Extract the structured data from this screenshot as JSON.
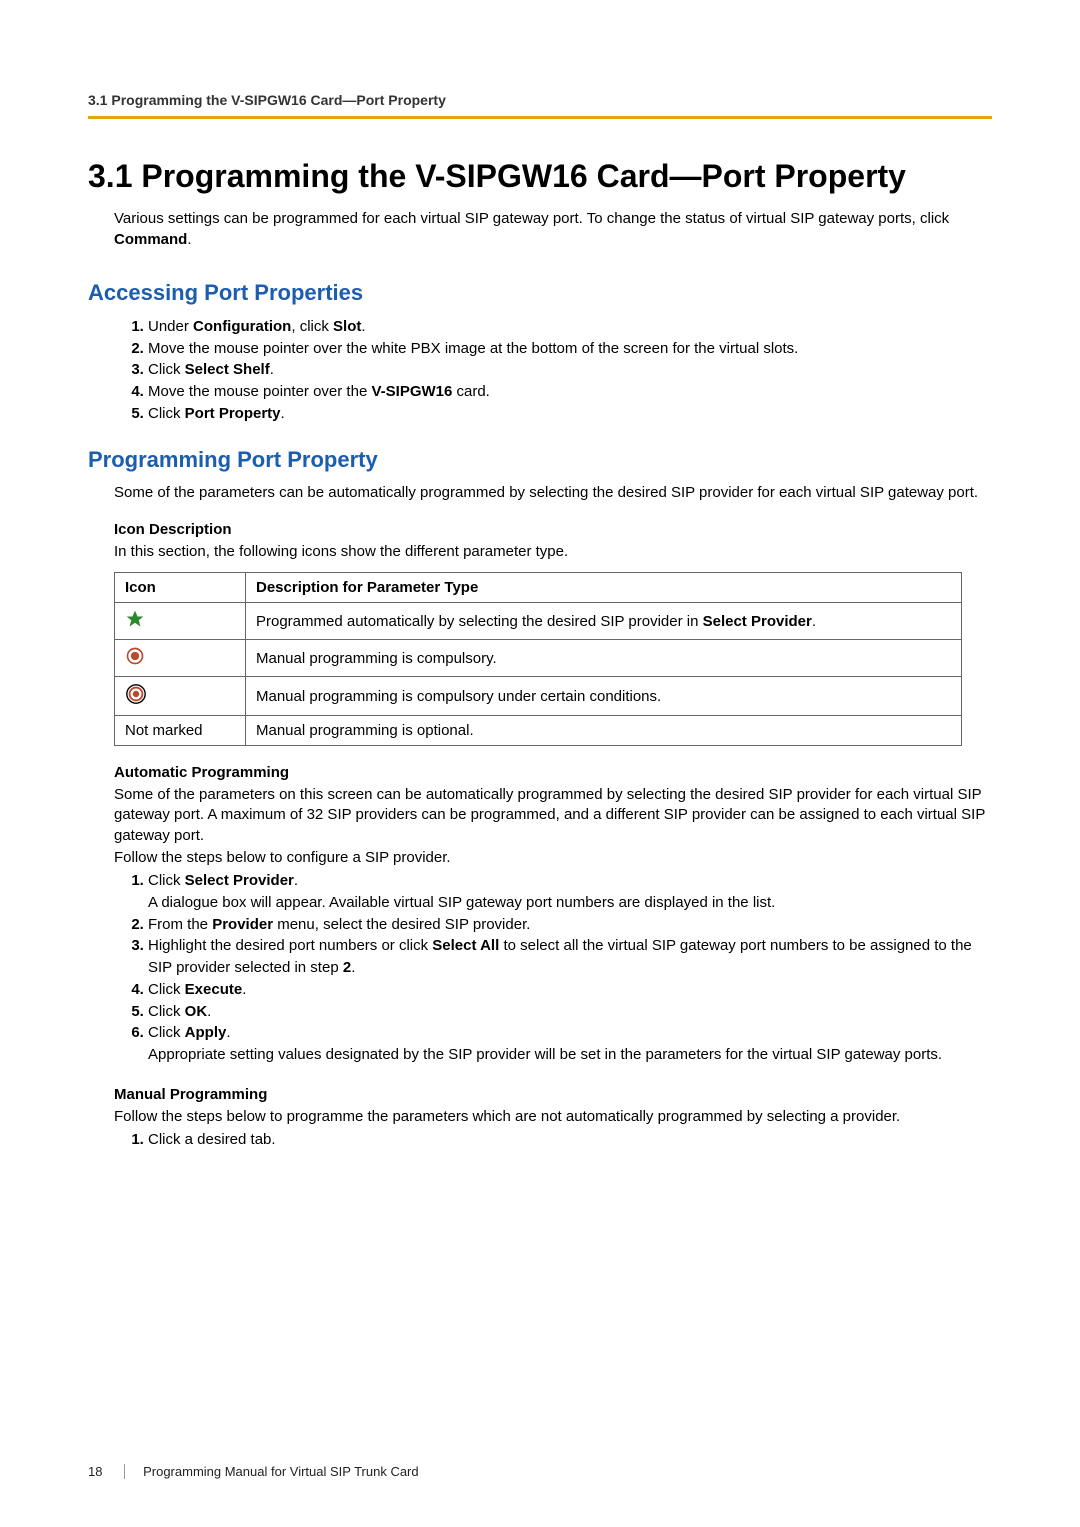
{
  "header": {
    "running": "3.1 Programming the V-SIPGW16 Card—Port Property"
  },
  "title": "3.1  Programming the V-SIPGW16 Card—Port Property",
  "intro": {
    "text_a": "Various settings can be programmed for each virtual SIP gateway port. To change the status of virtual SIP gateway ports, click ",
    "bold_a": "Command",
    "text_b": "."
  },
  "section_accessing": {
    "heading": "Accessing Port Properties",
    "steps": [
      {
        "pre": "Under ",
        "b1": "Configuration",
        "mid": ", click ",
        "b2": "Slot",
        "post": "."
      },
      {
        "text": "Move the mouse pointer over the white PBX image at the bottom of the screen for the virtual slots."
      },
      {
        "pre": "Click ",
        "b1": "Select Shelf",
        "post": "."
      },
      {
        "pre": "Move the mouse pointer over the ",
        "b1": "V-SIPGW16",
        "post": " card."
      },
      {
        "pre": "Click ",
        "b1": "Port Property",
        "post": "."
      }
    ]
  },
  "section_programming": {
    "heading": "Programming Port Property",
    "intro": "Some of the parameters can be automatically programmed by selecting the desired SIP provider for each virtual SIP gateway port.",
    "icon_desc_heading": "Icon Description",
    "icon_desc_text": "In this section, the following icons show the different parameter type.",
    "table": {
      "headers": {
        "icon": "Icon",
        "desc": "Description for Parameter Type"
      },
      "rows": [
        {
          "iconName": "star-icon",
          "iconText": "",
          "desc_pre": "Programmed automatically by selecting the desired SIP provider in ",
          "desc_bold": "Select Provider",
          "desc_post": "."
        },
        {
          "iconName": "circle-solid-icon",
          "iconText": "",
          "desc": "Manual programming is compulsory."
        },
        {
          "iconName": "circle-outline-icon",
          "iconText": "",
          "desc": "Manual programming is compulsory under certain conditions."
        },
        {
          "iconName": "not-marked",
          "iconText": "Not marked",
          "desc": "Manual programming is optional."
        }
      ]
    },
    "auto_heading": "Automatic Programming",
    "auto_p1": "Some of the parameters on this screen can be automatically programmed by selecting the desired SIP provider for each virtual SIP gateway port. A maximum of 32 SIP providers can be programmed, and a different SIP provider can be assigned to each virtual SIP gateway port.",
    "auto_p2": "Follow the steps below to configure a SIP provider.",
    "auto_steps": [
      {
        "pre": "Click ",
        "b1": "Select Provider",
        "post": ".",
        "line2": "A dialogue box will appear. Available virtual SIP gateway port numbers are displayed in the list."
      },
      {
        "pre": "From the ",
        "b1": "Provider",
        "post": " menu, select the desired SIP provider."
      },
      {
        "pre": "Highlight the desired port numbers or click ",
        "b1": "Select All",
        "mid": " to select all the virtual SIP gateway port numbers to be assigned to the SIP provider selected in step ",
        "b2": "2",
        "post": "."
      },
      {
        "pre": "Click ",
        "b1": "Execute",
        "post": "."
      },
      {
        "pre": "Click ",
        "b1": "OK",
        "post": "."
      },
      {
        "pre": "Click ",
        "b1": "Apply",
        "post": ".",
        "line2": "Appropriate setting values designated by the SIP provider will be set in the parameters for the virtual SIP gateway ports."
      }
    ],
    "manual_heading": "Manual Programming",
    "manual_p1": "Follow the steps below to programme the parameters which are not automatically programmed by selecting a provider.",
    "manual_steps": [
      {
        "text": "Click a desired tab."
      }
    ]
  },
  "footer": {
    "page": "18",
    "title": "Programming Manual for Virtual SIP Trunk Card"
  }
}
